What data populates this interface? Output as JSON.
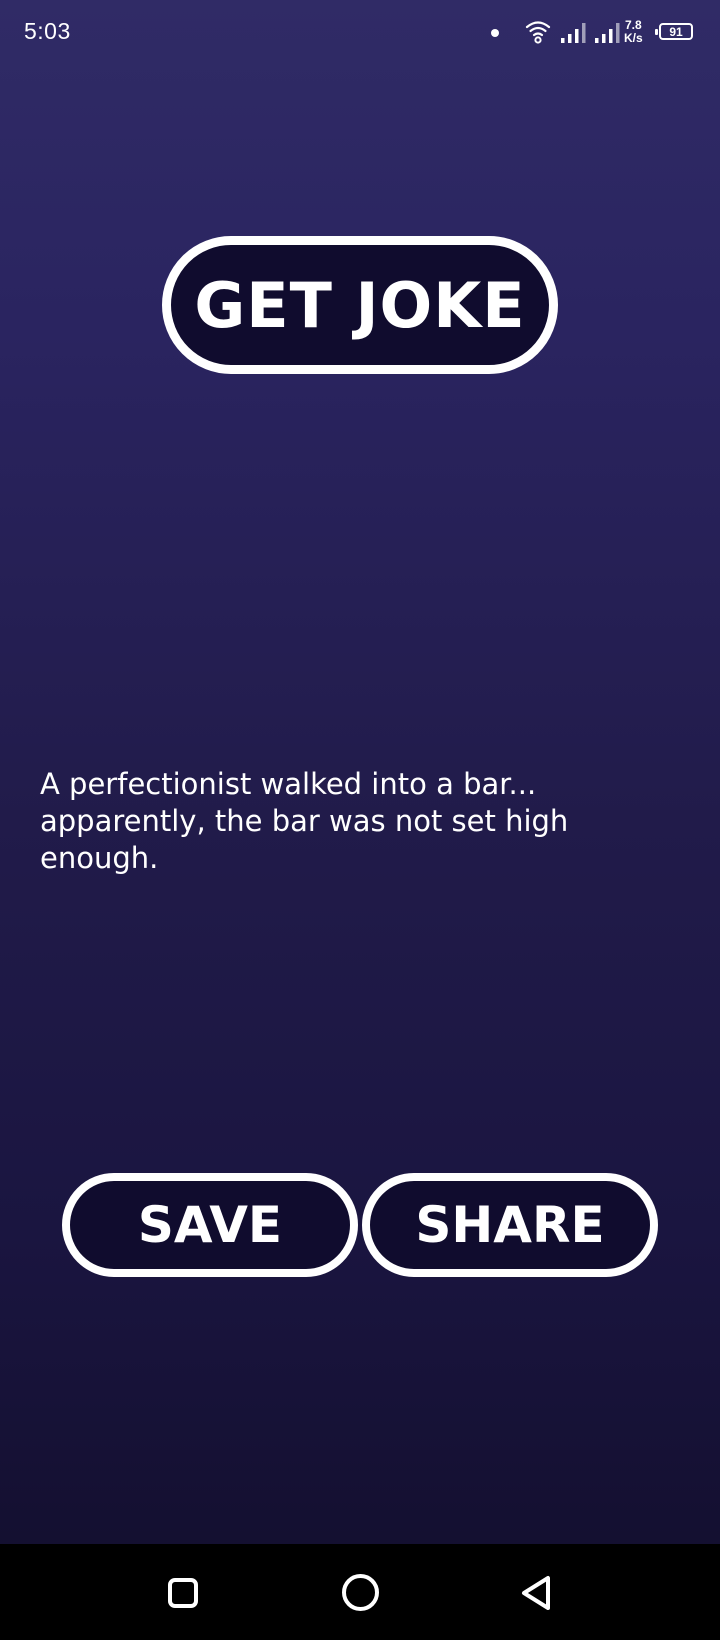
{
  "status_bar": {
    "time": "5:03",
    "network_speed_value": "7.8",
    "network_speed_unit": "K/s",
    "battery_level": "91",
    "icons": [
      "notification-dot-icon",
      "wifi-icon",
      "signal-icon",
      "signal-icon",
      "battery-icon"
    ]
  },
  "main": {
    "get_joke_label": "GET JOKE",
    "joke_text": "A perfectionist walked into a bar... apparently, the bar was not set high enough.",
    "save_label": "SAVE",
    "share_label": "SHARE"
  },
  "nav_bar": {
    "icons": [
      "recent-apps-icon",
      "home-icon",
      "back-icon"
    ]
  },
  "colors": {
    "background_top": "#302b66",
    "background_bottom": "#120e2c",
    "button_fill": "#100c2e",
    "button_border": "#ffffff",
    "text": "#ffffff"
  }
}
